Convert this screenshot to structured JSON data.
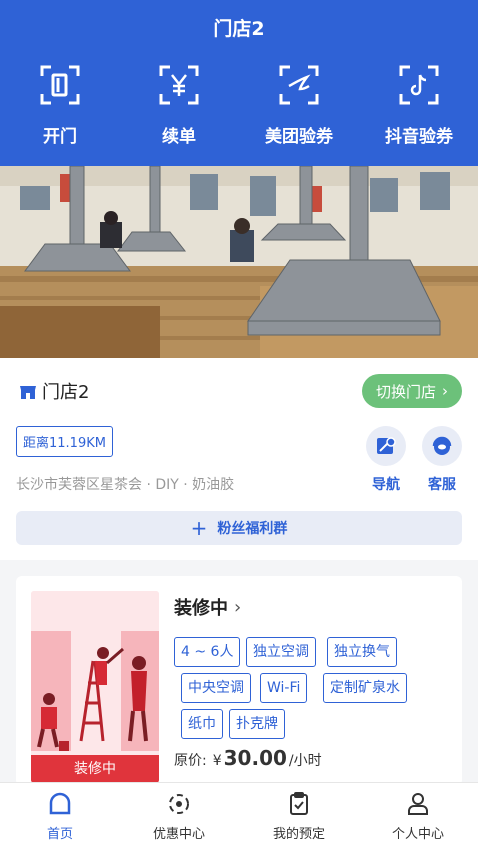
{
  "header": {
    "title": "门店2",
    "actions": [
      {
        "label": "开门",
        "icon": "door-icon"
      },
      {
        "label": "续单",
        "icon": "yen-icon"
      },
      {
        "label": "美团验券",
        "icon": "meituan-icon"
      },
      {
        "label": "抖音验券",
        "icon": "douyin-icon"
      }
    ]
  },
  "store": {
    "name": "门店2",
    "switch_label": "切换门店",
    "distance": "距离11.19KM",
    "address": "长沙市芙蓉区星茶会 · DIY · 奶油胶",
    "navigate_label": "导航",
    "service_label": "客服",
    "fans_label": "粉丝福利群"
  },
  "room": {
    "status": "装修中",
    "image_overlay": "装修中",
    "tags": [
      "4 ~ 6人",
      "独立空调",
      "独立换气",
      "中央空调",
      "Wi-Fi",
      "定制矿泉水",
      "纸巾",
      "扑克牌"
    ],
    "price_label": "原价:",
    "currency": "¥",
    "price": "30.00",
    "unit": "/小时"
  },
  "tabbar": [
    {
      "label": "首页",
      "active": true
    },
    {
      "label": "优惠中心",
      "active": false
    },
    {
      "label": "我的预定",
      "active": false
    },
    {
      "label": "个人中心",
      "active": false
    }
  ],
  "colors": {
    "primary": "#2f62d6",
    "green": "#6cc17a",
    "red": "#e0343c"
  }
}
